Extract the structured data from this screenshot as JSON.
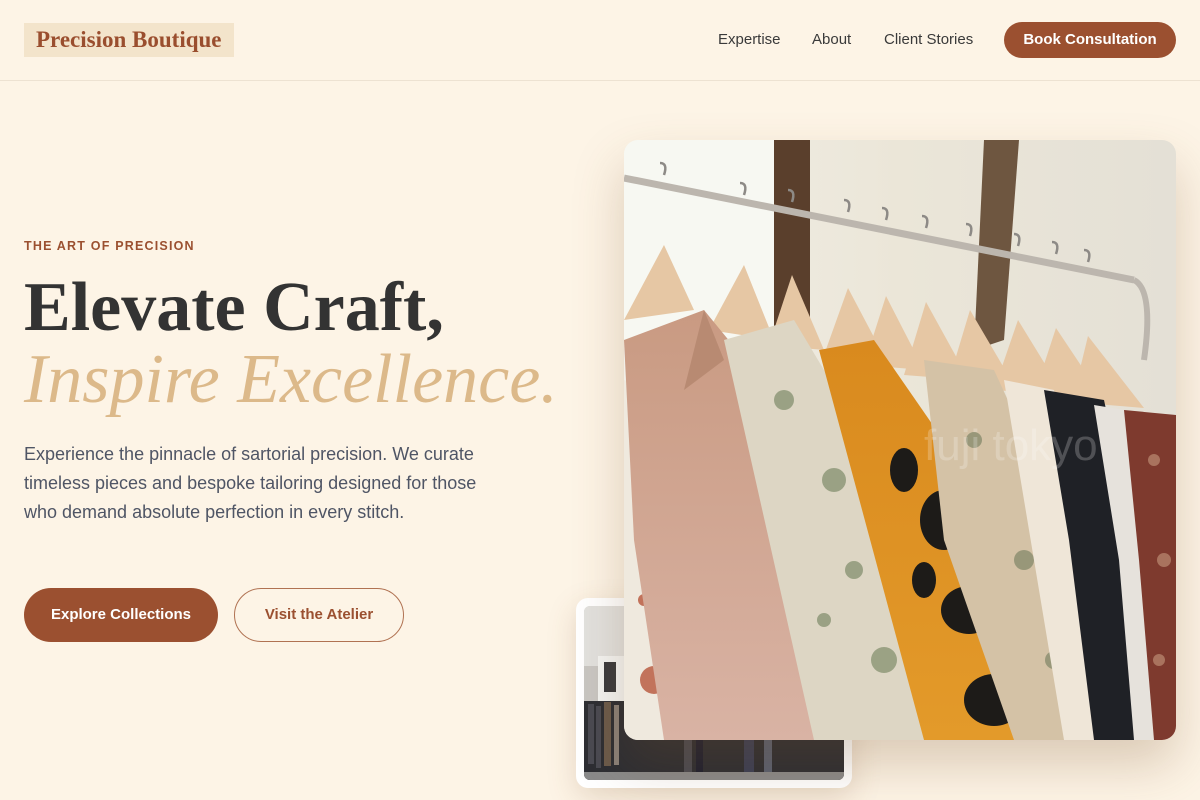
{
  "header": {
    "logo": "Precision Boutique",
    "nav": [
      "Expertise",
      "About",
      "Client Stories"
    ],
    "cta": "Book Consultation"
  },
  "hero": {
    "eyebrow": "THE ART OF PRECISION",
    "title_line1": "Elevate Craft,",
    "title_line2": "Inspire Excellence.",
    "description": "Experience the pinnacle of sartorial precision. We curate timeless pieces and bespoke tailoring designed for those who demand absolute perfection in every stitch.",
    "primary_button": "Explore Collections",
    "secondary_button": "Visit the Atelier"
  },
  "images": {
    "main_watermark": "fuji tokyo"
  },
  "colors": {
    "background": "#fdf4e6",
    "accent": "#9b5030",
    "accent_light": "#dcb98a",
    "body_text": "#4f5565"
  }
}
